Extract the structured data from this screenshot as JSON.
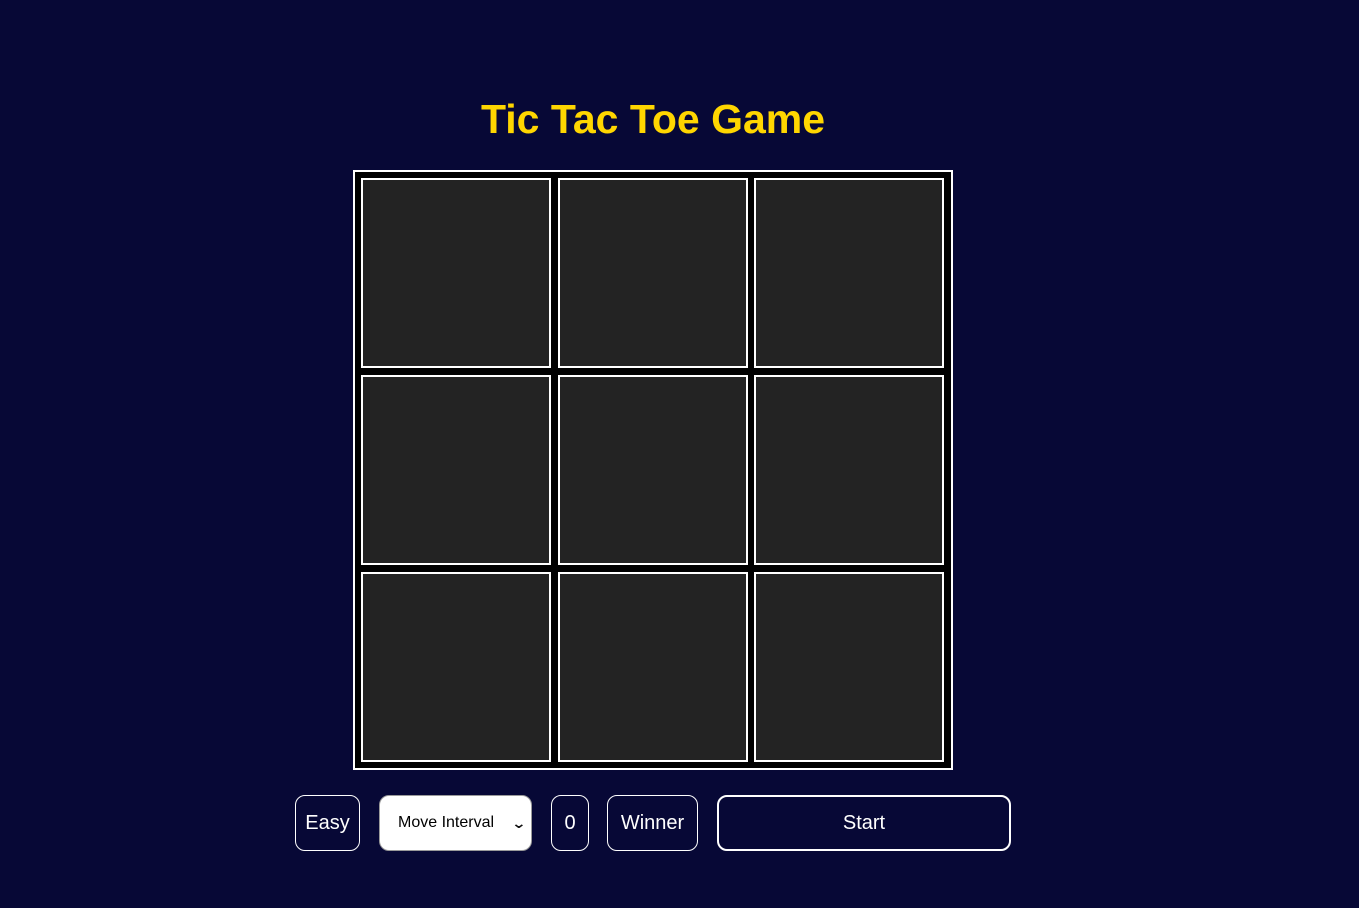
{
  "title": "Tic Tac Toe Game",
  "board": {
    "cells": [
      "",
      "",
      "",
      "",
      "",
      "",
      "",
      "",
      ""
    ]
  },
  "controls": {
    "difficulty": "Easy",
    "interval": {
      "selected": "Move Interval"
    },
    "score": "0",
    "winner": "Winner",
    "start": "Start"
  },
  "colors": {
    "background": "#070836",
    "title": "#ffd600",
    "cell": "#232323",
    "border": "#ffffff"
  }
}
